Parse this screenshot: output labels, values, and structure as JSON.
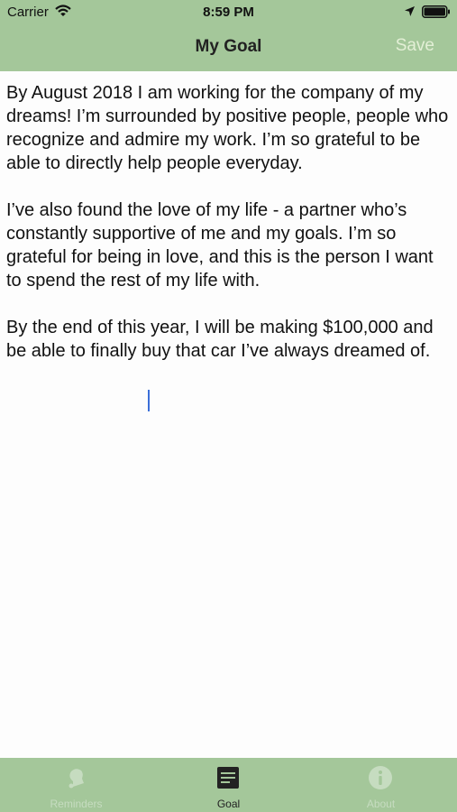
{
  "status": {
    "carrier": "Carrier",
    "time": "8:59 PM"
  },
  "nav": {
    "title": "My Goal",
    "save_label": "Save"
  },
  "goal": {
    "text": "By August 2018 I am working for the company of my dreams! I’m surrounded by positive people, people who recognize and admire my work. I’m so grateful to be able to directly help people everyday.\n\nI’ve also found the love of my life - a partner who’s constantly supportive of me and my goals. I’m so grateful for being in love, and this is the person I want to spend the rest of my life with.\n\nBy the end of this year, I will be making $100,000 and be able to finally buy that car I’ve always dreamed of."
  },
  "tabs": [
    {
      "label": "Reminders",
      "icon": "bell-icon",
      "active": false
    },
    {
      "label": "Goal",
      "icon": "notepad-icon",
      "active": true
    },
    {
      "label": "About",
      "icon": "info-icon",
      "active": false
    }
  ],
  "colors": {
    "bar_green": "#a4c79a",
    "save_text": "#e3efd6",
    "inactive_tab": "#c6dcc0",
    "cursor": "#3b6fd8"
  }
}
